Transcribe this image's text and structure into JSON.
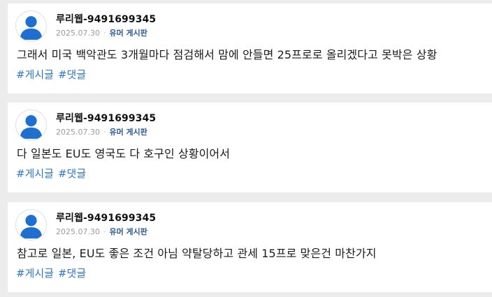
{
  "posts": [
    {
      "author": "루리웹-9491699345",
      "date": "2025.07.30",
      "board": "유머 게시판",
      "content": "그래서 미국 백악관도 3개월마다 점검해서 맘에 안들면 25프로로 올리겠다고 못박은 상황",
      "tags": [
        "#게시글",
        "#댓글"
      ]
    },
    {
      "author": "루리웹-9491699345",
      "date": "2025.07.30",
      "board": "유머 게시판",
      "content": "다 일본도 EU도 영국도 다 호구인 상황이어서",
      "tags": [
        "#게시글",
        "#댓글"
      ]
    },
    {
      "author": "루리웹-9491699345",
      "date": "2025.07.30",
      "board": "유머 게시판",
      "content": "참고로 일본, EU도 좋은 조건 아님 약탈당하고 관세 15프로 맞은건 마찬가지",
      "tags": [
        "#게시글",
        "#댓글"
      ]
    }
  ],
  "icons": {
    "avatar": "user-silhouette-icon",
    "avatar_color": "#1f6fd1"
  },
  "colors": {
    "tag": "#2f75c9",
    "board": "#2d5b95",
    "meta": "#9a9a9a"
  }
}
